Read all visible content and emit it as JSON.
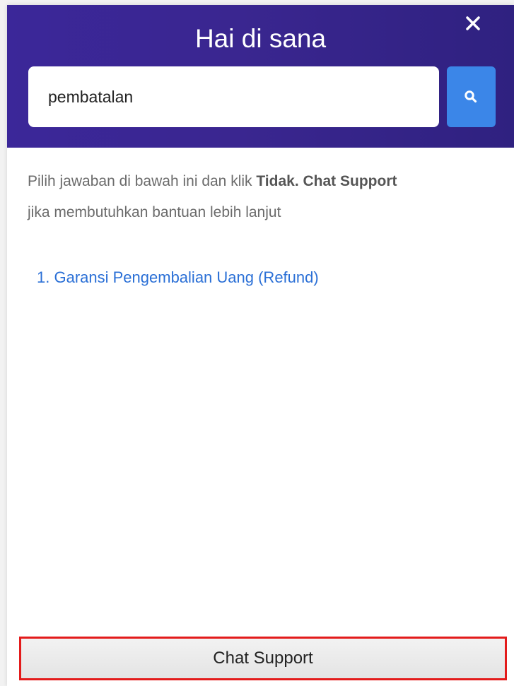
{
  "header": {
    "title": "Hai di sana",
    "close_icon": "close-icon",
    "background_color": "#3a2690"
  },
  "search": {
    "value": "pembatalan",
    "placeholder": "",
    "button_icon": "search-icon",
    "button_color": "#3b86e8"
  },
  "instructions": {
    "prefix": "Pilih jawaban di bawah ini dan klik ",
    "bold": "Tidak. Chat Support",
    "suffix": "jika membutuhkan bantuan lebih lanjut"
  },
  "results": [
    {
      "number": "1.",
      "label": "Garansi Pengembalian Uang (Refund)"
    }
  ],
  "footer": {
    "chat_support_label": "Chat Support",
    "highlight_color": "#e31b1b"
  }
}
